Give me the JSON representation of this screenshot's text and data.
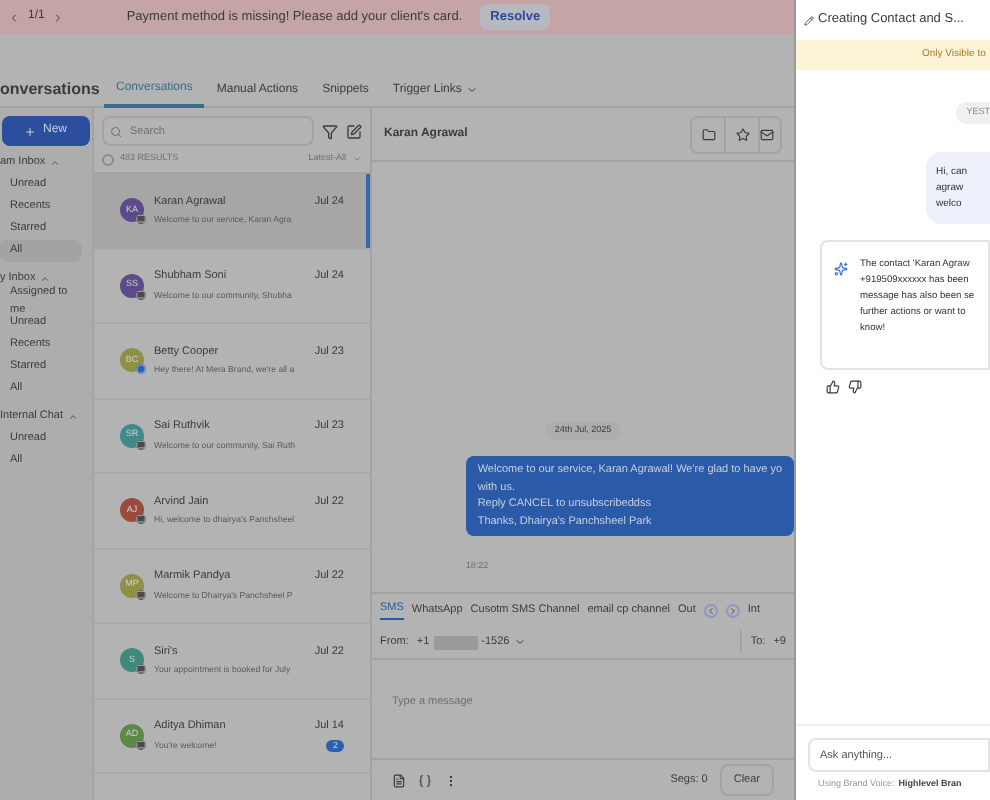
{
  "banner": {
    "pager": "1/1",
    "message": "Payment method is missing! Please add your client's card.",
    "action": "Resolve"
  },
  "header": {
    "title": "onversations",
    "tabs": [
      {
        "label": "Conversations",
        "selected": true
      },
      {
        "label": "Manual Actions",
        "selected": false
      },
      {
        "label": "Snippets",
        "selected": false
      },
      {
        "label": "Trigger Links",
        "selected": false
      }
    ]
  },
  "sidebar": {
    "new_button": "New",
    "groups": [
      {
        "label": "am Inbox",
        "expanded": true,
        "items": [
          {
            "label": "Unread",
            "selected": false
          },
          {
            "label": "Recents",
            "selected": false
          },
          {
            "label": "Starred",
            "selected": false
          },
          {
            "label": "All",
            "selected": true
          }
        ]
      },
      {
        "label": "y Inbox",
        "expanded": true,
        "items": [
          {
            "label": "Assigned to me",
            "selected": false
          },
          {
            "label": "Unread",
            "selected": false
          },
          {
            "label": "Recents",
            "selected": false
          },
          {
            "label": "Starred",
            "selected": false
          },
          {
            "label": "All",
            "selected": false
          }
        ]
      },
      {
        "label": "Internal Chat",
        "expanded": true,
        "items": [
          {
            "label": "Unread",
            "selected": false
          },
          {
            "label": "All",
            "selected": false
          }
        ]
      }
    ]
  },
  "list": {
    "search_placeholder": "Search",
    "select_all_checked": false,
    "results": "483 RESULTS",
    "sort": "Latest-All",
    "items": [
      {
        "initials": "KA",
        "name": "Karan Agrawal",
        "date": "Jul 24",
        "preview": "Welcome to our service, Karan Agra",
        "color": "#5b4b8a",
        "kind": "sms",
        "selected": true
      },
      {
        "initials": "SS",
        "name": "Shubham Soni",
        "date": "Jul 24",
        "preview": "Welcome to our community, Shubha",
        "color": "#5b4b8a",
        "kind": "sms",
        "selected": false
      },
      {
        "initials": "BC",
        "name": "Betty Cooper",
        "date": "Jul 23",
        "preview": "Hey there! At Mera Brand, we're all a",
        "color": "#8e9145",
        "kind": "messenger",
        "selected": false
      },
      {
        "initials": "SR",
        "name": "Sai Ruthvik",
        "date": "Jul 23",
        "preview": "Welcome to our community, Sai Ruth",
        "color": "#3f8a8a",
        "kind": "sms",
        "selected": false
      },
      {
        "initials": "AJ",
        "name": "Arvind Jain",
        "date": "Jul 22",
        "preview": "Hi, welcome to dhairya's Panchsheel",
        "color": "#9c4b3b",
        "kind": "sms",
        "selected": false
      },
      {
        "initials": "MP",
        "name": "Marmik Pandya",
        "date": "Jul 22",
        "preview": "Welcome to Dhairya's Panchsheel P",
        "color": "#8e9145",
        "kind": "sms",
        "selected": false
      },
      {
        "initials": "S",
        "name": "Siri's",
        "date": "Jul 22",
        "preview": "Your appointment is booked for July",
        "color": "#3f8a7a",
        "kind": "sms",
        "selected": false
      },
      {
        "initials": "AD",
        "name": "Aditya Dhiman",
        "date": "Jul 14",
        "preview": "You're welcome!",
        "color": "#5a8a45",
        "kind": "sms",
        "selected": false,
        "unread": "2"
      }
    ]
  },
  "chat": {
    "contact": "Karan Agrawal",
    "date": "24th Jul, 2025",
    "message": {
      "lines": [
        "Welcome to our service, Karan Agrawal! We're glad to have yo",
        "with us.",
        "Reply CANCEL to unsubscribeddss",
        "Thanks, Dhairya's Panchsheel Park"
      ],
      "time": "18:22"
    },
    "channels": [
      {
        "label": "SMS",
        "selected": true
      },
      {
        "label": "WhatsApp",
        "selected": false
      },
      {
        "label": "Cusotm SMS Channel",
        "selected": false
      },
      {
        "label": "email cp channel",
        "selected": false
      },
      {
        "label": "Out",
        "selected": false
      }
    ],
    "channel_more": "Int",
    "from_label": "From:",
    "from_prefix": "+1",
    "from_suffix": "-1526",
    "to_label": "To:",
    "to_value": "+9",
    "placeholder": "Type a message",
    "segs": "Segs: 0",
    "clear": "Clear"
  },
  "assistant": {
    "title": "Creating Contact and S...",
    "notice": "Only Visible to",
    "day_chip": "YEST",
    "user_lines": [
      "Hi, can",
      "agraw",
      "welco"
    ],
    "reply_lines": [
      "The contact 'Karan Agraw",
      "+919509xxxxxx has been",
      "message has also been se",
      "further actions or want to",
      "know!"
    ],
    "input_placeholder": "Ask anything...",
    "voice_label": "Using Brand Voice:",
    "voice_value": "Highlevel Bran"
  }
}
